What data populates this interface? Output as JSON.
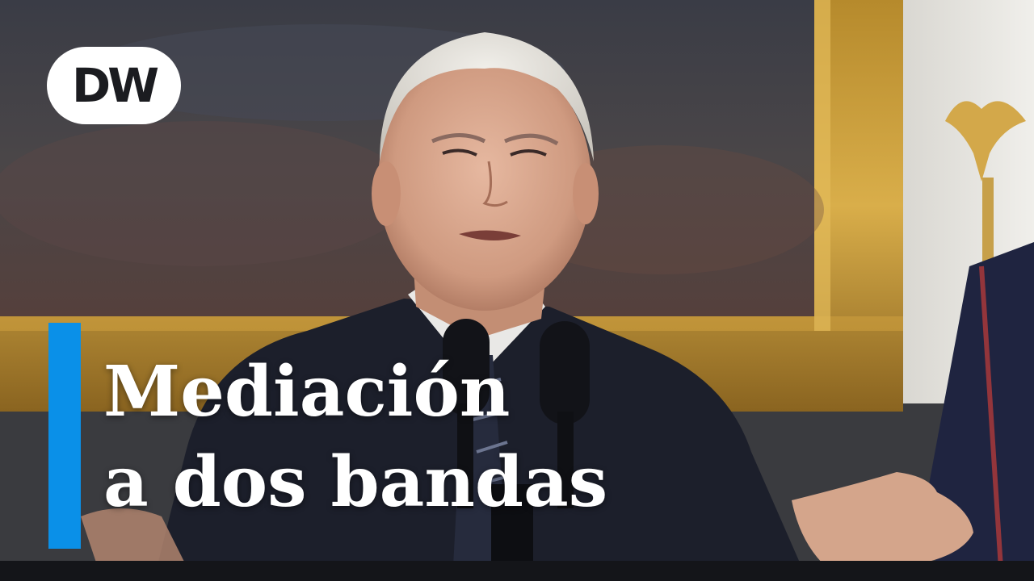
{
  "logo": {
    "text": "DW"
  },
  "headline": {
    "line1": "Mediación",
    "line2": "a dos bandas"
  },
  "colors": {
    "accent": "#0a90e8",
    "logo_bg": "#ffffff",
    "text": "#ffffff"
  },
  "icons": {
    "logo": "dw-logo-icon"
  }
}
